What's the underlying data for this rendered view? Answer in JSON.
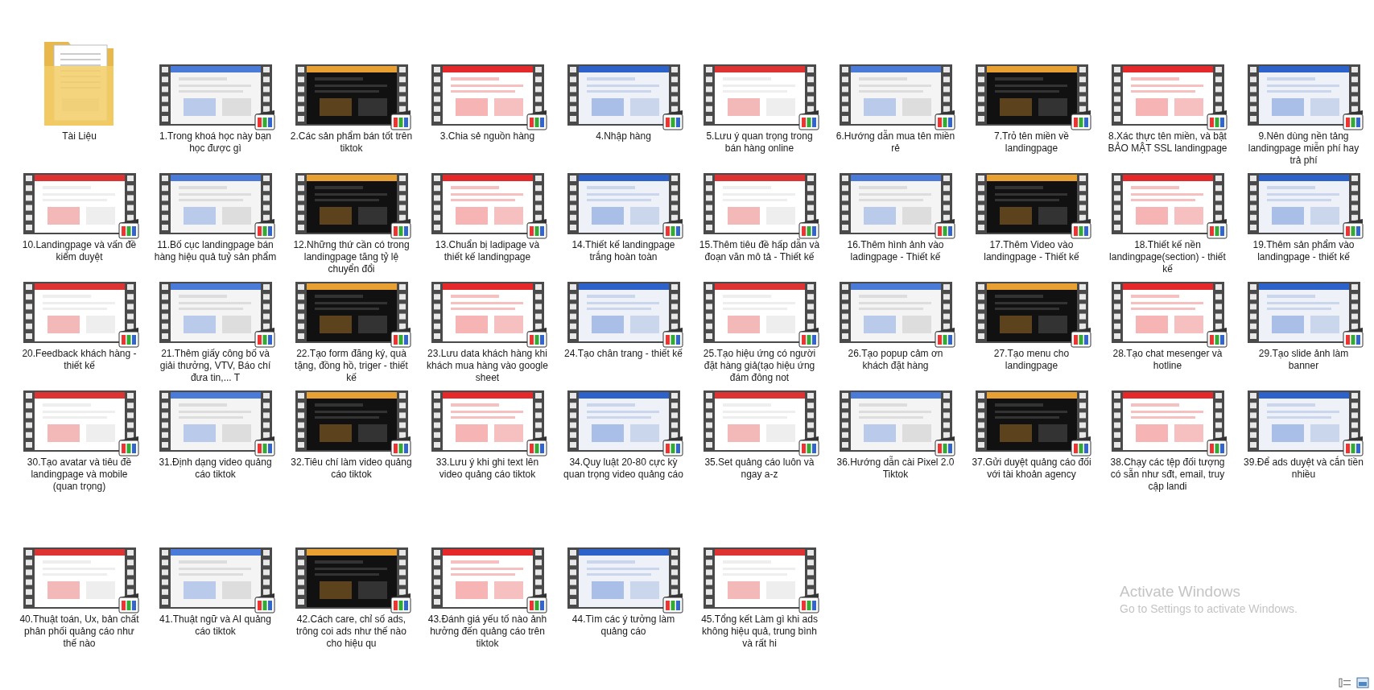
{
  "items": [
    {
      "kind": "folder",
      "label": "Tài Liệu"
    },
    {
      "kind": "video",
      "label": "1.Trong khoá học này bạn học được gì"
    },
    {
      "kind": "video",
      "label": "2.Các sản phẩm bán tốt trên tiktok"
    },
    {
      "kind": "video",
      "label": "3.Chia sẻ nguồn hàng"
    },
    {
      "kind": "video",
      "label": "4.Nhập hàng"
    },
    {
      "kind": "video",
      "label": "5.Lưu ý quan trọng trong bán hàng online"
    },
    {
      "kind": "video",
      "label": "6.Hướng dẫn mua tên miền rẻ"
    },
    {
      "kind": "video",
      "label": "7.Trỏ tên miền về landingpage"
    },
    {
      "kind": "video",
      "label": "8.Xác thực tên miền, và bật BẢO MẬT SSL landingpage"
    },
    {
      "kind": "video",
      "label": "9.Nên dùng nền tảng landingpage miễn phí hay trả phí"
    },
    {
      "kind": "video",
      "label": "10.Landingpage và vấn đề kiểm duyệt"
    },
    {
      "kind": "video",
      "label": "11.Bố cục landingpage bán hàng hiệu quả tuỷ sản phẩm"
    },
    {
      "kind": "video",
      "label": "12.Những thứ cần có trong landingpage tăng tỷ lệ chuyển đổi"
    },
    {
      "kind": "video",
      "label": "13.Chuẩn bị ladipage và thiết kế landingpage"
    },
    {
      "kind": "video",
      "label": "14.Thiết kế landingpage trắng hoàn toàn"
    },
    {
      "kind": "video",
      "label": "15.Thêm tiêu đề hấp dẫn và đoạn văn mô tả - Thiết kế"
    },
    {
      "kind": "video",
      "label": "16.Thêm hình ảnh vào ladingpage - Thiết kế"
    },
    {
      "kind": "video",
      "label": "17.Thêm Video vào landingpage - Thiết kế"
    },
    {
      "kind": "video",
      "label": "18.Thiết kế nền landingpage(section) - thiết kế"
    },
    {
      "kind": "video",
      "label": "19.Thêm sản phẩm vào landingpage - thiết kế"
    },
    {
      "kind": "video",
      "label": "20.Feedback khách hàng - thiết kế"
    },
    {
      "kind": "video",
      "label": "21.Thêm giấy công bố và giải thưởng, VTV, Báo chí đưa tin,... T"
    },
    {
      "kind": "video",
      "label": "22.Tạo form đăng ký, quà tặng, đồng hồ, triger - thiết kế"
    },
    {
      "kind": "video",
      "label": "23.Lưu data khách hàng khi khách mua hàng vào google sheet"
    },
    {
      "kind": "video",
      "label": "24.Tạo chân trang - thiết kế"
    },
    {
      "kind": "video",
      "label": "25.Tạo hiệu ứng có người đặt hàng giả(tạo hiệu ứng đám đông not"
    },
    {
      "kind": "video",
      "label": "26.Tạo popup cảm ơn khách đặt hàng"
    },
    {
      "kind": "video",
      "label": "27.Tạo menu cho landingpage"
    },
    {
      "kind": "video",
      "label": "28.Tạo chat mesenger và hotline"
    },
    {
      "kind": "video",
      "label": "29.Tạo slide ảnh làm banner"
    },
    {
      "kind": "video",
      "label": "30.Tạo avatar và tiêu đề landingpage và mobile (quan trọng)"
    },
    {
      "kind": "video",
      "label": "31.Định dạng video quảng cáo tiktok"
    },
    {
      "kind": "video",
      "label": "32.Tiêu chí làm video quảng cáo tiktok"
    },
    {
      "kind": "video",
      "label": "33.Lưu ý khi ghi text lên video quảng cáo tiktok"
    },
    {
      "kind": "video",
      "label": "34.Quy luật 20-80 cực kỳ quan trọng video quảng cáo"
    },
    {
      "kind": "video",
      "label": "35.Set quảng cáo luôn và ngay a-z"
    },
    {
      "kind": "video",
      "label": "36.Hướng dẫn cài Pixel 2.0 Tiktok"
    },
    {
      "kind": "video",
      "label": "37.Gửi duyệt quảng cáo đối với tài khoản agency"
    },
    {
      "kind": "video",
      "label": "38.Chạy các tệp đối tượng có sẵn như sđt, email, truy cập landi"
    },
    {
      "kind": "video",
      "label": "39.Để ads duyệt và cắn tiền nhiều"
    },
    {
      "kind": "video",
      "label": "40.Thuật toán, Ux, bản chất phân phối quảng cáo như thế nào"
    },
    {
      "kind": "video",
      "label": "41.Thuật ngữ và AI quảng cáo tiktok"
    },
    {
      "kind": "video",
      "label": "42.Cách care, chỉ số ads, trông coi ads như thế nào cho hiệu qu"
    },
    {
      "kind": "video",
      "label": "43.Đánh giá yếu tố nào ảnh hưởng đến quảng cáo trên tiktok"
    },
    {
      "kind": "video",
      "label": "44.Tìm các ý tưởng làm quảng cáo"
    },
    {
      "kind": "video",
      "label": "45.Tổng kết Làm gì khi ads không hiệu quả, trung bình và rất hi"
    }
  ],
  "activation": {
    "title": "Activate Windows",
    "message": "Go to Settings to activate Windows."
  }
}
